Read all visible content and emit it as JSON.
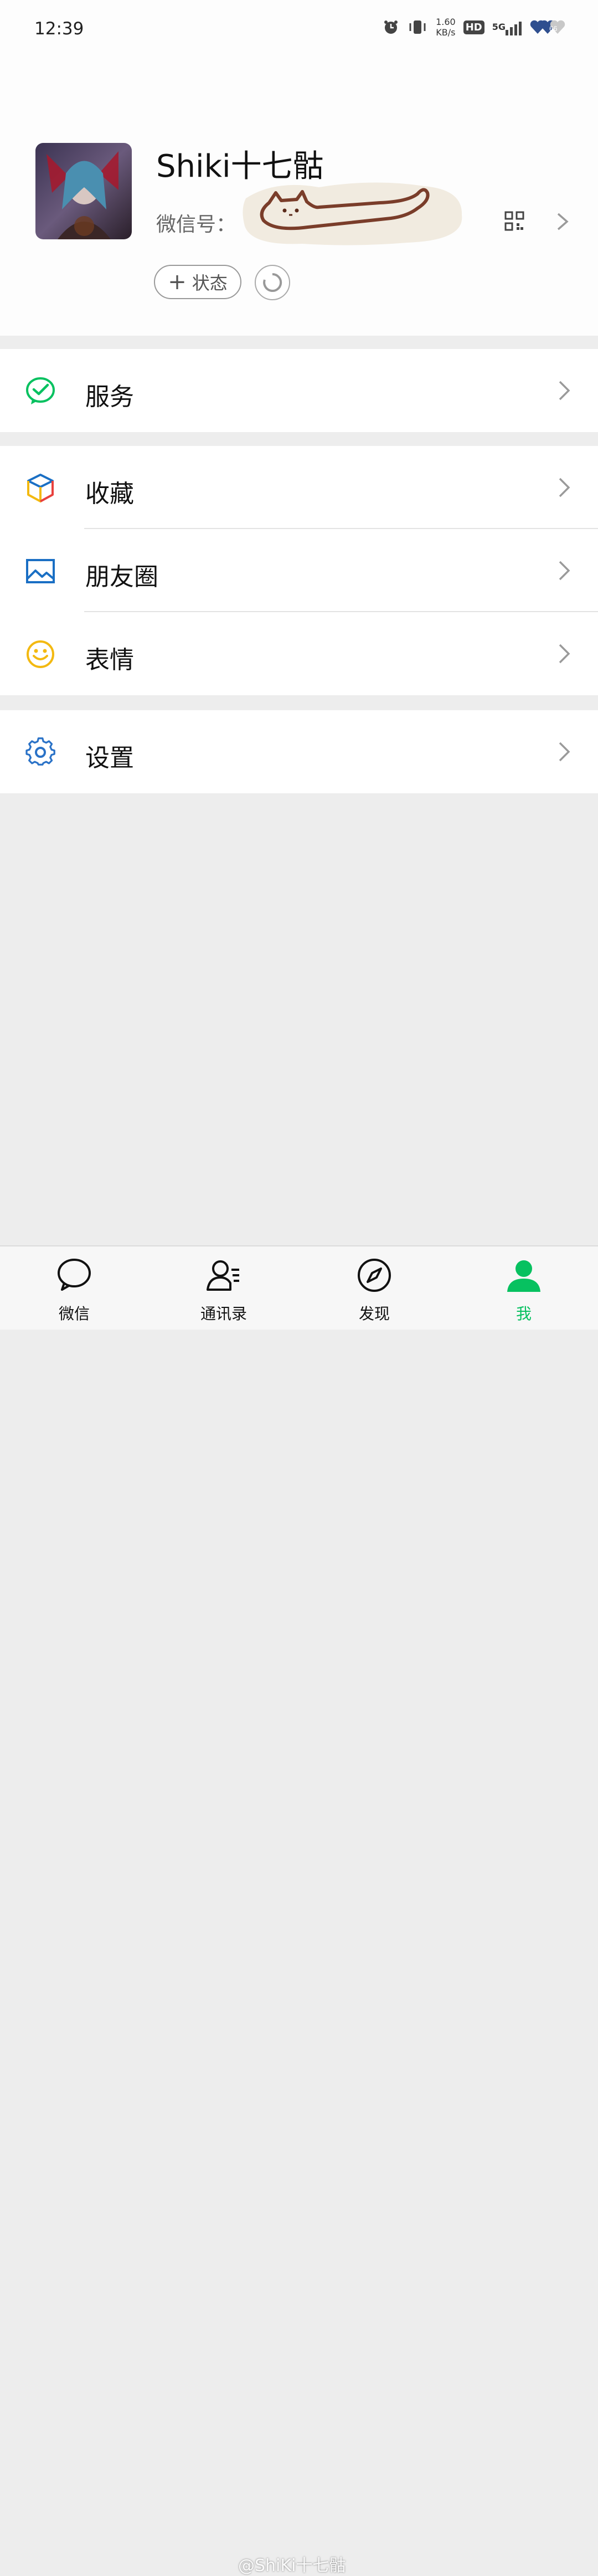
{
  "status_bar": {
    "time": "12:39",
    "net_speed_value": "1.60",
    "net_speed_unit": "KB/s",
    "hd": "HD",
    "network": "5G",
    "battery": "66"
  },
  "profile": {
    "nickname": "Shiki十七骷",
    "wechat_id_label": "微信号：",
    "status_button": "状态"
  },
  "menu": {
    "services": "服务",
    "favorites": "收藏",
    "moments": "朋友圈",
    "stickers": "表情",
    "settings": "设置"
  },
  "tabs": [
    {
      "label": "微信"
    },
    {
      "label": "通讯录"
    },
    {
      "label": "发现"
    },
    {
      "label": "我"
    }
  ],
  "watermark": "@ShiKi十七骷",
  "colors": {
    "brand_green": "#07c160",
    "moments_blue": "#1a6fc4",
    "settings_blue": "#2a72c7",
    "stickers_yellow": "#f3b911"
  }
}
